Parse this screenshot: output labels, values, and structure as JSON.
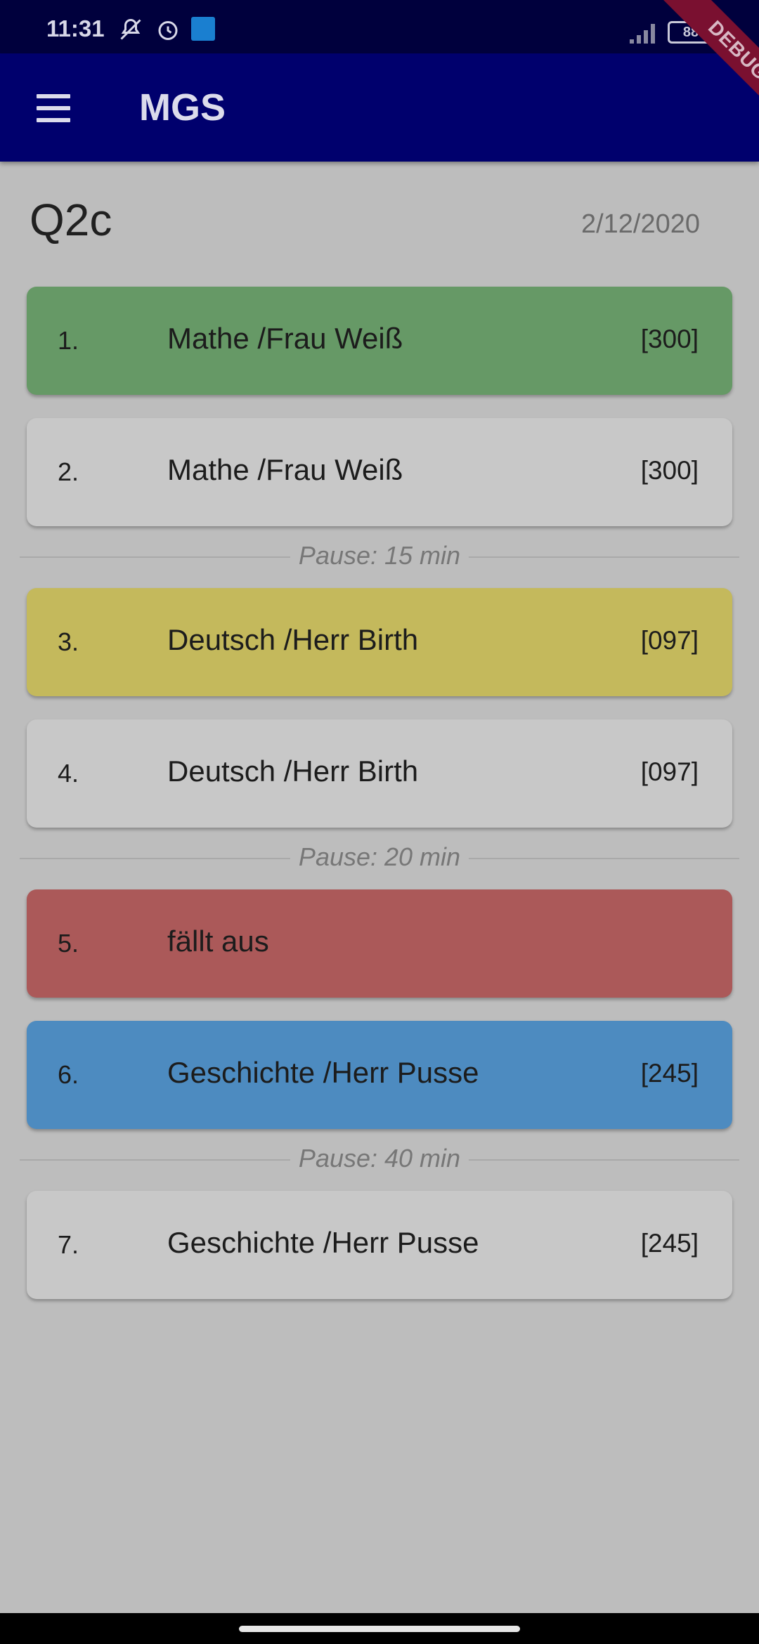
{
  "status_bar": {
    "time": "11:31",
    "battery": "88",
    "icons": [
      "notifications-off-icon",
      "alarm-icon",
      "app-notification-icon",
      "signal-icon",
      "battery-icon"
    ]
  },
  "app_bar": {
    "title": "MGS",
    "menu_icon": "menu-icon",
    "background": "#00006d"
  },
  "debug_banner": "DEBUG",
  "header": {
    "class_name": "Q2c",
    "date": "2/12/2020"
  },
  "periods": [
    {
      "number": "1.",
      "subject": "Mathe /Frau Weiß",
      "room": "[300]",
      "color": "#669966"
    },
    {
      "number": "2.",
      "subject": "Mathe /Frau Weiß",
      "room": "[300]",
      "color": "#c8c8c8"
    },
    {
      "number": "3.",
      "subject": "Deutsch /Herr Birth",
      "room": "[097]",
      "color": "#c4b95c"
    },
    {
      "number": "4.",
      "subject": "Deutsch /Herr Birth",
      "room": "[097]",
      "color": "#c8c8c8"
    },
    {
      "number": "5.",
      "subject": "fällt aus",
      "room": "",
      "color": "#ab5959"
    },
    {
      "number": "6.",
      "subject": "Geschichte /Herr Pusse",
      "room": "[245]",
      "color": "#4d8bc0"
    },
    {
      "number": "7.",
      "subject": "Geschichte /Herr Pusse",
      "room": "[245]",
      "color": "#c8c8c8"
    }
  ],
  "pauses": [
    {
      "label": "Pause: 15 min"
    },
    {
      "label": "Pause: 20 min"
    },
    {
      "label": "Pause: 40 min"
    }
  ]
}
